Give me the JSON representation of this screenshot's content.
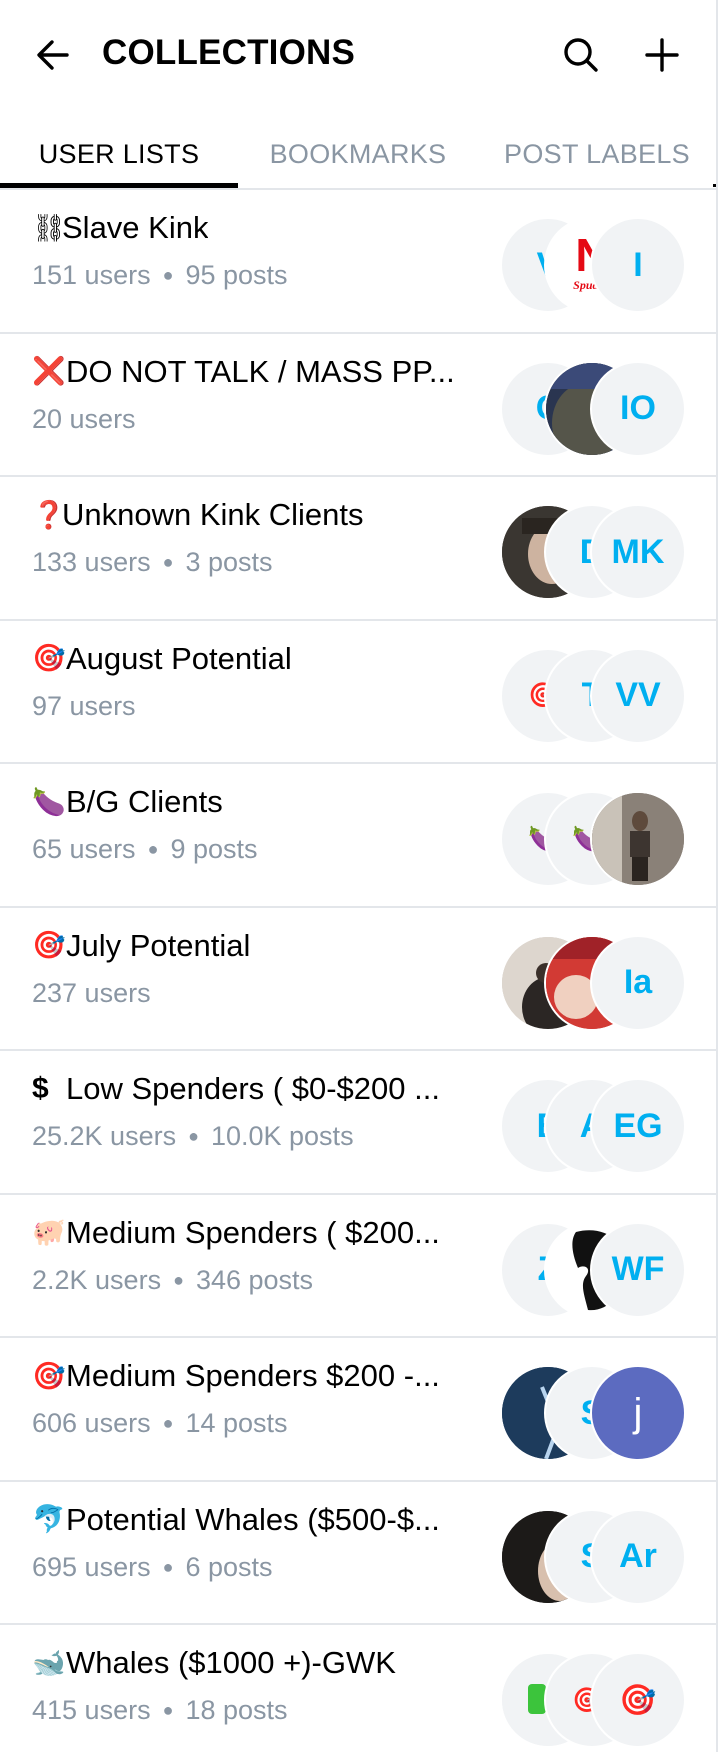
{
  "header": {
    "title": "COLLECTIONS",
    "back_icon": "arrow-left-icon",
    "search_icon": "search-icon",
    "add_icon": "plus-icon"
  },
  "tabs": [
    {
      "label": "USER LISTS",
      "active": true
    },
    {
      "label": "BOOKMARKS",
      "active": false
    },
    {
      "label": "POST LABELS",
      "active": false
    }
  ],
  "colors": {
    "accent": "#00aff0",
    "muted": "#8a96a3",
    "divider": "#e3e6ea",
    "avatar_bg": "#f1f3f5"
  },
  "lists": [
    {
      "emoji": "⛓",
      "title": "Slave Kink",
      "users": "151 users",
      "posts": "95 posts",
      "avatars": [
        "V",
        "N",
        "I"
      ]
    },
    {
      "emoji": "❌",
      "title": "DO NOT TALK / MASS PP...",
      "users": "20 users",
      "posts": "",
      "avatars": [
        "C",
        "",
        "IO"
      ]
    },
    {
      "emoji": "❓",
      "title": "Unknown Kink Clients",
      "users": "133 users",
      "posts": "3 posts",
      "avatars": [
        "",
        "D",
        "MK"
      ]
    },
    {
      "emoji": "🎯",
      "title": "August Potential",
      "users": "97 users",
      "posts": "",
      "avatars": [
        "🎯",
        "T",
        "VV"
      ]
    },
    {
      "emoji": "🍆",
      "title": "B/G Clients",
      "users": "65 users",
      "posts": "9 posts",
      "avatars": [
        "🍆",
        "🍆",
        ""
      ]
    },
    {
      "emoji": "🎯",
      "title": "July Potential",
      "users": "237 users",
      "posts": "",
      "avatars": [
        "",
        "",
        "Ia"
      ]
    },
    {
      "emoji": "💲",
      "title": "Low Spenders ( $0-$200 ...",
      "users": "25.2K users",
      "posts": "10.0K posts",
      "avatars": [
        "E",
        "A",
        "EG"
      ]
    },
    {
      "emoji": "🐖",
      "title": "Medium Spenders ( $200...",
      "users": "2.2K users",
      "posts": "346 posts",
      "avatars": [
        "Z",
        "",
        "WF"
      ]
    },
    {
      "emoji": "🎯",
      "title": "Medium Spenders $200 -...",
      "users": "606 users",
      "posts": "14 posts",
      "avatars": [
        "",
        "S",
        "j"
      ]
    },
    {
      "emoji": "🐬",
      "title": "Potential Whales ($500-$...",
      "users": "695 users",
      "posts": "6 posts",
      "avatars": [
        "",
        "S",
        "Ar"
      ]
    },
    {
      "emoji": "🐋",
      "title": "Whales ($1000 +)-GWK",
      "users": "415 users",
      "posts": "18 posts",
      "avatars": [
        "",
        "🎯",
        "🎯"
      ]
    }
  ]
}
